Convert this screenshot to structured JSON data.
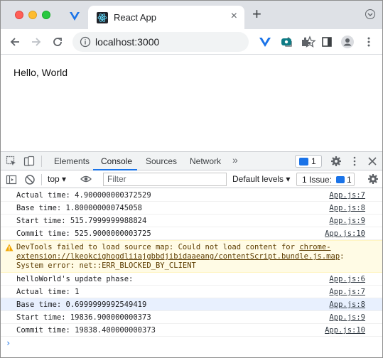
{
  "browser": {
    "tab_title": "React App",
    "url": "localhost:3000"
  },
  "page": {
    "text": "Hello, World"
  },
  "devtools": {
    "tabs": [
      "Elements",
      "Console",
      "Sources",
      "Network"
    ],
    "active_tab": "Console",
    "more": "»",
    "issue_count": "1",
    "context": "top ▾",
    "filter_placeholder": "Filter",
    "levels": "Default levels ▾",
    "issues_label": "1 Issue:",
    "issues_count": "1",
    "accent": "#1a73e8"
  },
  "console": {
    "rows": [
      {
        "msg": "Actual time: 4.900000000372529",
        "src": "App.js:7"
      },
      {
        "msg": "Base time: 1.800000000745058",
        "src": "App.js:8"
      },
      {
        "msg": "Start time: 515.7999999988824",
        "src": "App.js:9"
      },
      {
        "msg": "Commit time: 525.9000000003725",
        "src": "App.js:10"
      }
    ],
    "warning": {
      "prefix": "DevTools failed to load source map: Could not load content for ",
      "link": "chrome-extension://lkeokcighogdliiajgbbdjibidaaeang/contentScript.bundle.js.map",
      "suffix": ": System error: net::ERR_BLOCKED_BY_CLIENT"
    },
    "rows2": [
      {
        "msg": "helloWorld's update phase:",
        "src": "App.js:6"
      },
      {
        "msg": "Actual time: 1",
        "src": "App.js:7"
      },
      {
        "msg": "Base time: 0.6999999992549419",
        "src": "App.js:8"
      },
      {
        "msg": "Start time: 19836.900000000373",
        "src": "App.js:9"
      },
      {
        "msg": "Commit time: 19838.400000000373",
        "src": "App.js:10"
      }
    ],
    "prompt": "›"
  }
}
